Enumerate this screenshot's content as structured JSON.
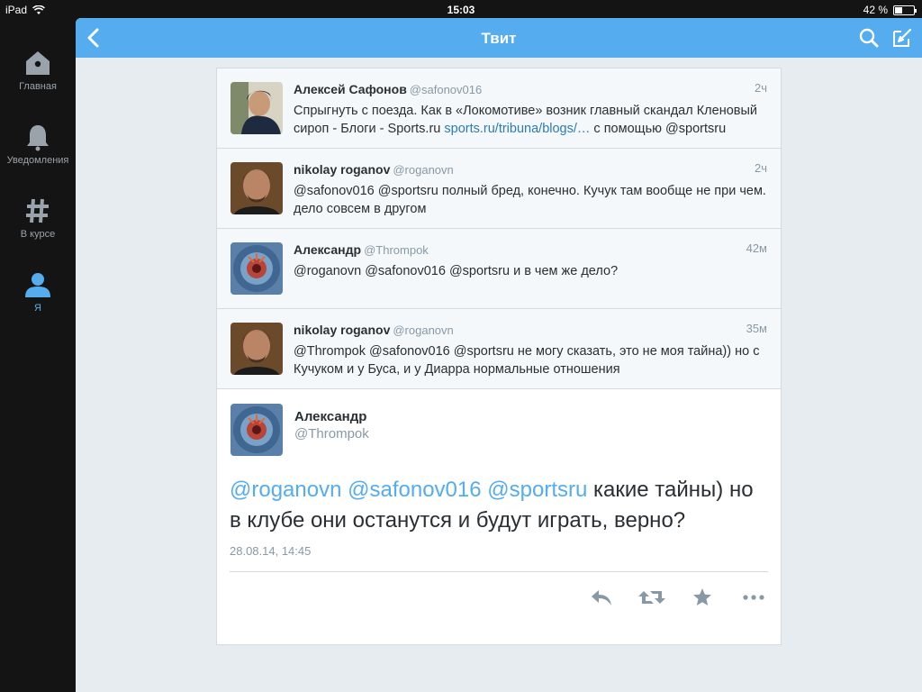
{
  "status": {
    "device": "iPad",
    "time": "15:03",
    "battery": "42 %",
    "battery_level": 0.42
  },
  "sidebar": {
    "items": [
      {
        "label": "Главная",
        "icon": "home-icon"
      },
      {
        "label": "Уведомления",
        "icon": "bell-icon"
      },
      {
        "label": "В курсе",
        "icon": "hashtag-icon"
      },
      {
        "label": "Я",
        "icon": "user-icon",
        "active": true
      }
    ]
  },
  "header": {
    "title": "Твит"
  },
  "replies": [
    {
      "name": "Алексей Сафонов",
      "handle": "@safonov016",
      "time": "2ч",
      "text": "Спрыгнуть с поезда. Как в «Локомотиве» возник главный скандал Кленовый сироп - Блоги - Sports.ru ",
      "link": "sports.ru/tribuna/blogs/…",
      "text_after": " с помощью @sportsru"
    },
    {
      "name": "nikolay roganov",
      "handle": "@roganovn",
      "time": "2ч",
      "text": "@safonov016 @sportsru полный бред, конечно. Кучук там вообще не при чем. дело совсем в другом"
    },
    {
      "name": "Александр",
      "handle": "@Thrompok",
      "time": "42м",
      "text": "@roganovn @safonov016 @sportsru и в чем же дело?"
    },
    {
      "name": "nikolay roganov",
      "handle": "@roganovn",
      "time": "35м",
      "text": "@Thrompok @safonov016 @sportsru не могу сказать, это не моя тайна)) но с Кучуком и у Буса, и у Диарра нормальные отношения"
    }
  ],
  "main_tweet": {
    "name": "Александр",
    "handle": "@Thrompok",
    "mentions": [
      "@roganovn",
      "@safonov016",
      "@sportsru"
    ],
    "text": "какие тайны) но в клубе они останутся и будут играть, верно?",
    "date": "28.08.14, 14:45",
    "actions": [
      "reply-icon",
      "retweet-icon",
      "favorite-icon",
      "more-icon"
    ]
  },
  "colors": {
    "accent": "#55acee",
    "link": "#2b7bb9",
    "muted": "#8899a6",
    "sidebar": "#141414"
  }
}
